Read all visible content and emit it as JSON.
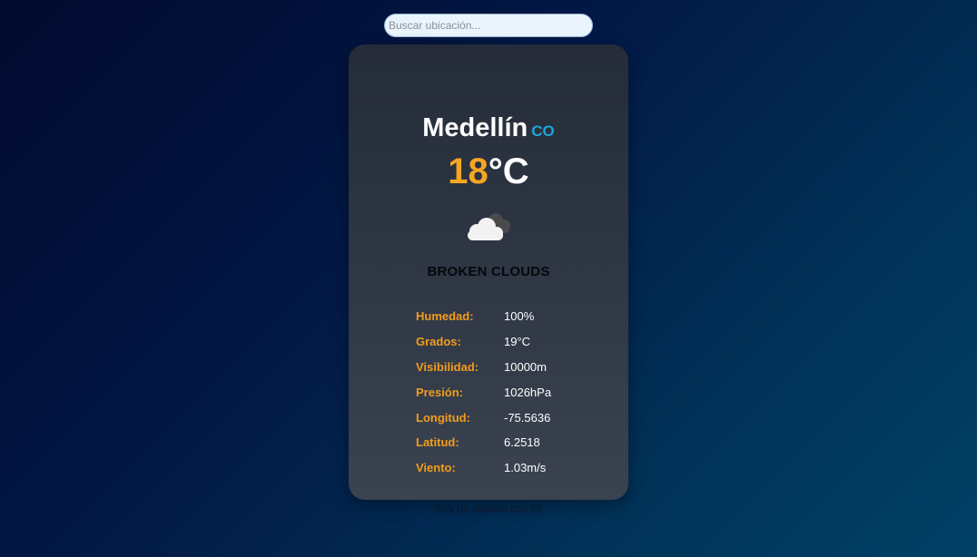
{
  "search": {
    "placeholder": "Buscar ubicación...",
    "value": ""
  },
  "weather": {
    "city": "Medellín",
    "country_code": "CO",
    "temperature": "18",
    "temperature_unit": "°C",
    "icon": "broken-clouds-icon",
    "description": "BROKEN CLOUDS",
    "details": [
      {
        "label": "Humedad:",
        "value": "100%"
      },
      {
        "label": "Grados:",
        "value": "19°C"
      },
      {
        "label": "Visibilidad:",
        "value": "10000m"
      },
      {
        "label": "Presión:",
        "value": "1026hPa"
      },
      {
        "label": "Longitud:",
        "value": "-75.5636"
      },
      {
        "label": "Latitud:",
        "value": "6.2518"
      },
      {
        "label": "Viento:",
        "value": "1.03m/s"
      }
    ]
  },
  "footer": {
    "text": "Soy un cambio con CI"
  },
  "colors": {
    "accent_orange": "#f39c1b",
    "temperature": "#f5a623",
    "country_code": "#1aa7db",
    "card_background": "#2f3745"
  }
}
